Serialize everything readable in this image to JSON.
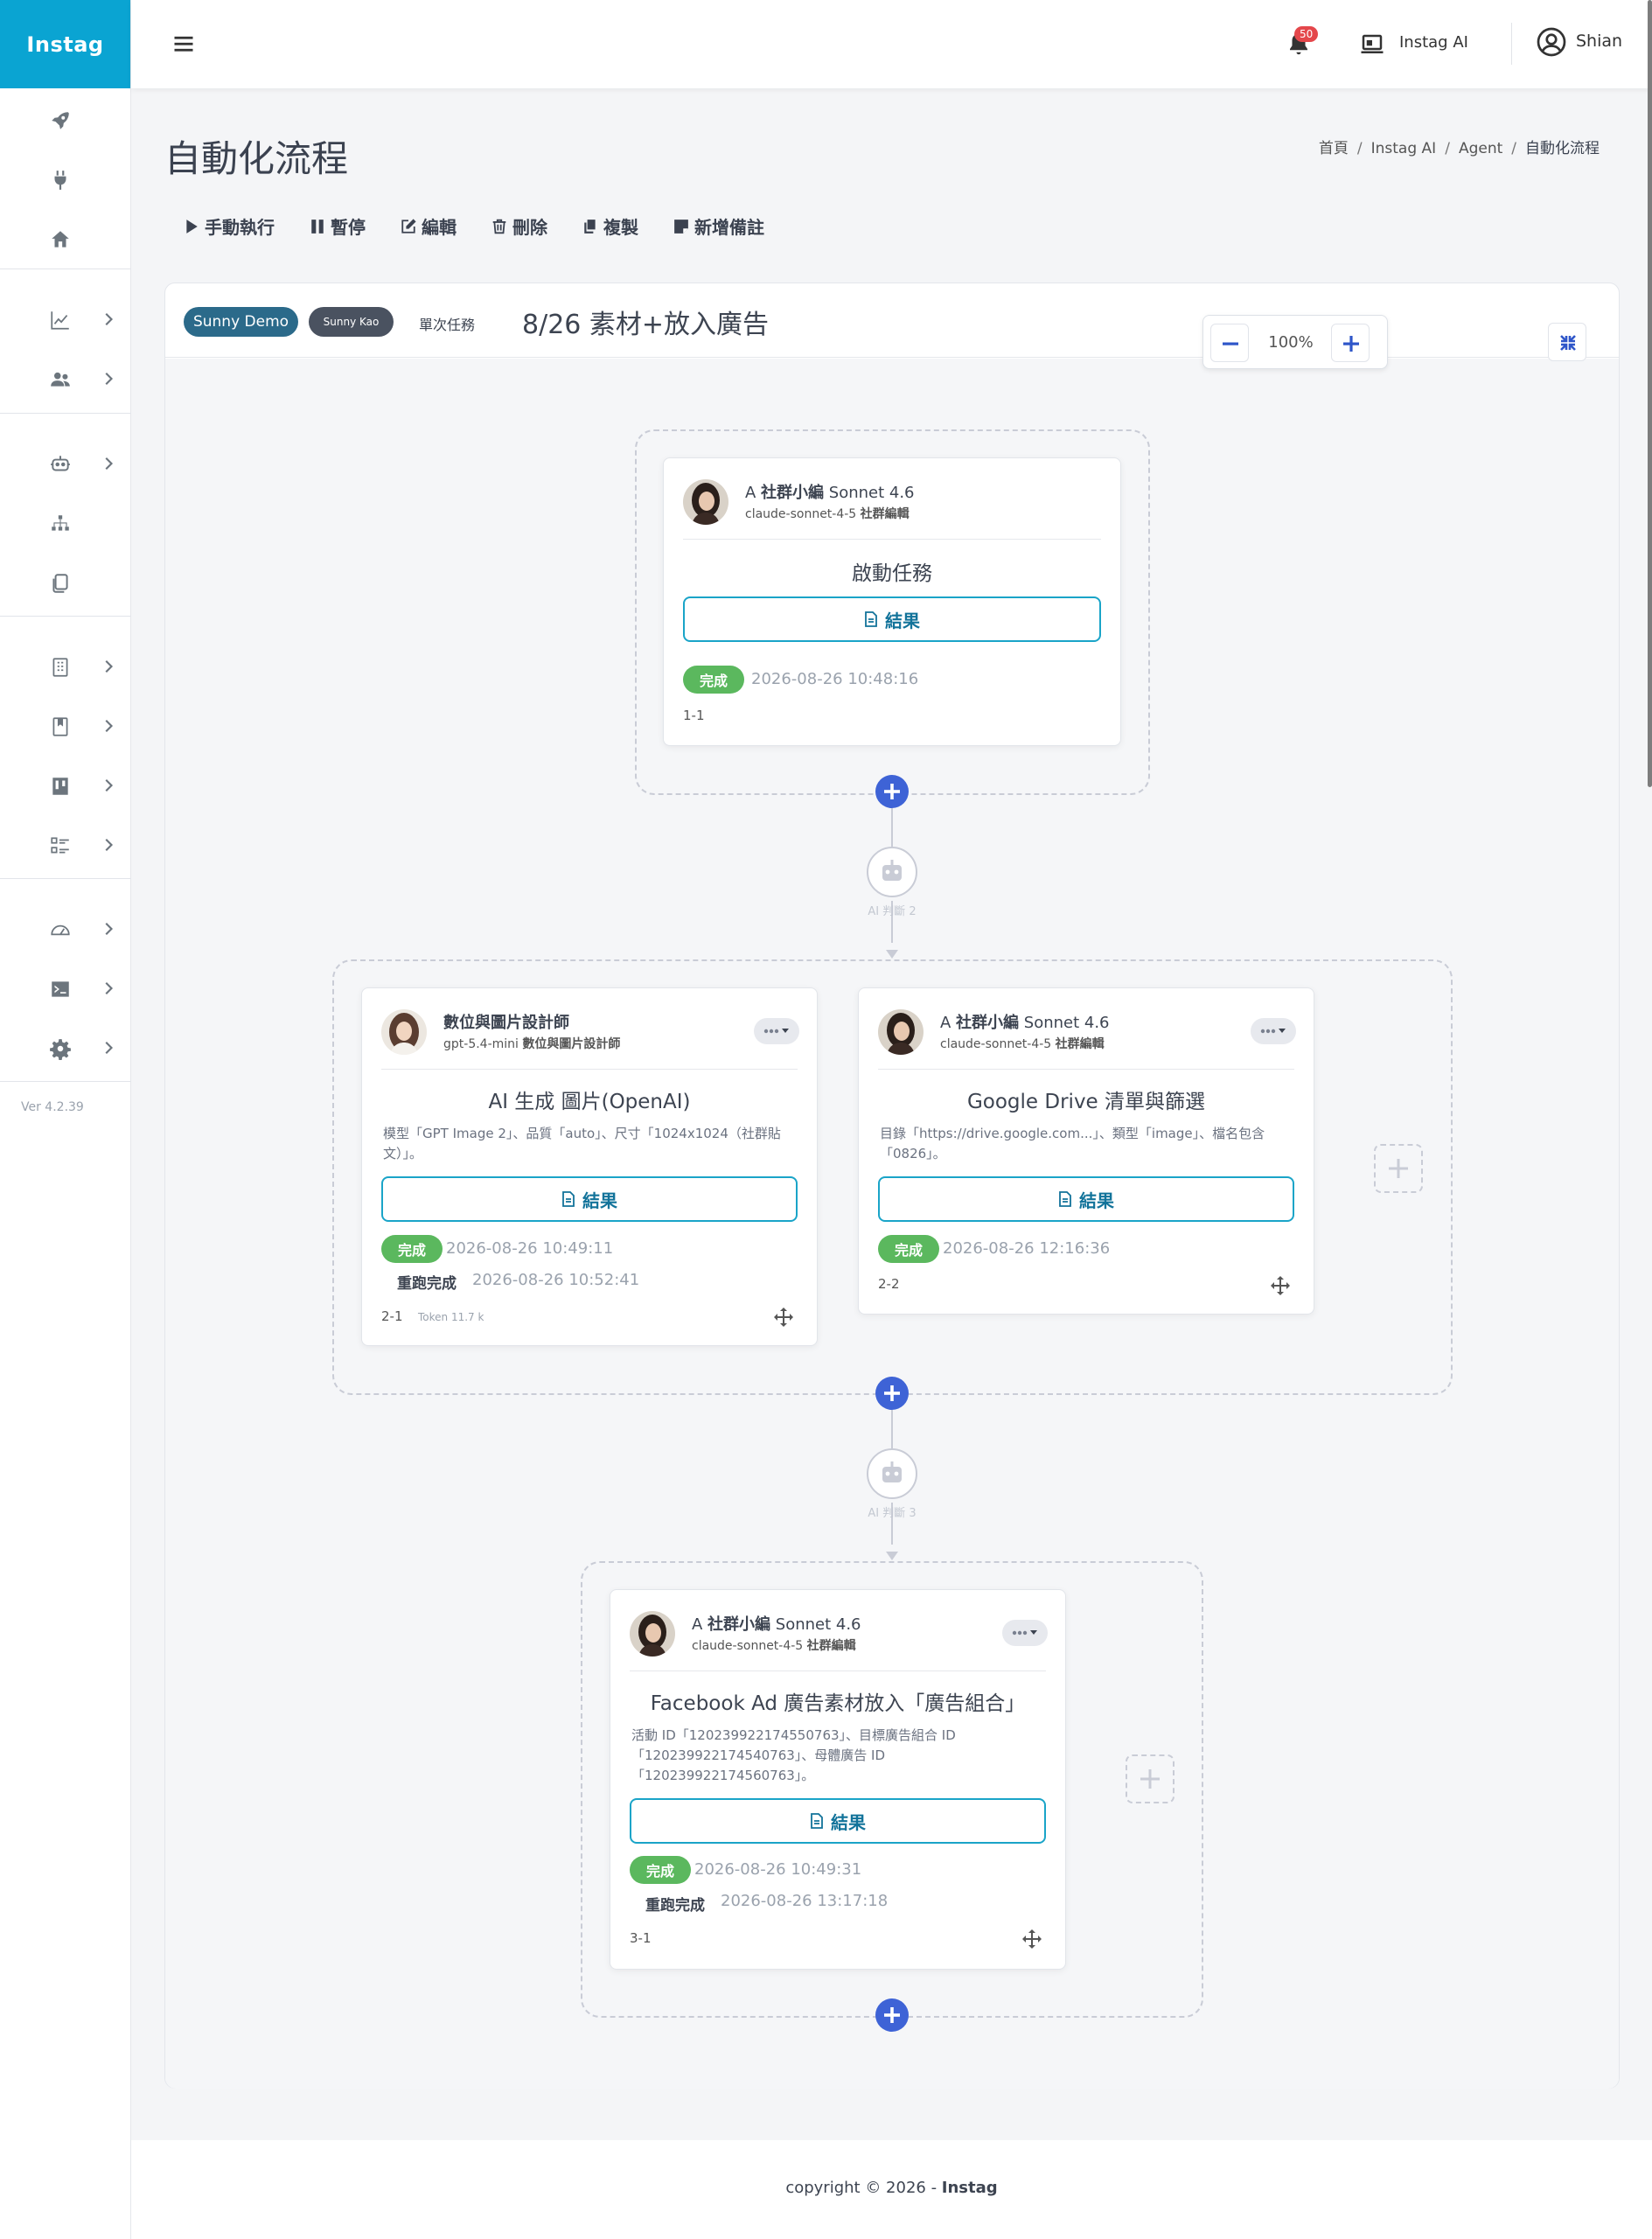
{
  "brand": "Instag",
  "topbar": {
    "notification_count": "50",
    "ai_label": "Instag AI",
    "user_name": "Shian"
  },
  "sidebar": {
    "version": "Ver 4.2.39"
  },
  "page": {
    "title": "自動化流程",
    "breadcrumb": [
      "首頁",
      "Instag AI",
      "Agent",
      "自動化流程"
    ],
    "actions": [
      "手動執行",
      "暫停",
      "編輯",
      "刪除",
      "複製",
      "新增備註"
    ]
  },
  "task": {
    "team": "Sunny Demo",
    "user": "Sunny Kao",
    "type": "單次任務",
    "title": "8/26 素材+放入廣告"
  },
  "zoom": {
    "value": "100%"
  },
  "labels": {
    "result": "結果",
    "done": "完成",
    "rerun": "重跑完成"
  },
  "ai_judges": [
    "AI 判斷 2",
    "AI 判斷 3"
  ],
  "nodes": {
    "n1": {
      "agent_prefix": "A ",
      "agent_bold": "社群小編",
      "agent_suffix": " Sonnet 4.6",
      "model": "claude-sonnet-4-5",
      "role": "社群編輯",
      "task": "啟動任務",
      "done_time": "2026-08-26 10:48:16",
      "id": "1-1"
    },
    "n21": {
      "agent_bold": "數位與圖片設計師",
      "model": "gpt-5.4-mini",
      "role": "數位與圖片設計師",
      "task": "AI 生成 圖片(OpenAI)",
      "desc": "模型「GPT Image 2」、品質「auto」、尺寸「1024x1024（社群貼文）」。",
      "done_time": "2026-08-26 10:49:11",
      "rerun_time": "2026-08-26 10:52:41",
      "id": "2-1",
      "token": "Token 11.7 k"
    },
    "n22": {
      "agent_prefix": "A ",
      "agent_bold": "社群小編",
      "agent_suffix": " Sonnet 4.6",
      "model": "claude-sonnet-4-5",
      "role": "社群編輯",
      "task": "Google Drive 清單與篩選",
      "desc": "目錄「https://drive.google.com...」、類型「image」、檔名包含「0826」。",
      "done_time": "2026-08-26 12:16:36",
      "id": "2-2"
    },
    "n31": {
      "agent_prefix": "A ",
      "agent_bold": "社群小編",
      "agent_suffix": " Sonnet 4.6",
      "model": "claude-sonnet-4-5",
      "role": "社群編輯",
      "task": "Facebook Ad 廣告素材放入「廣告組合」",
      "desc": "活動 ID「120239922174550763」、目標廣告組合 ID「120239922174540763」、母體廣告 ID「120239922174560763」。",
      "done_time": "2026-08-26 10:49:31",
      "rerun_time": "2026-08-26 13:17:18",
      "id": "3-1"
    }
  },
  "footer": {
    "prefix": "copyright © 2026 - ",
    "brand": "Instag"
  }
}
